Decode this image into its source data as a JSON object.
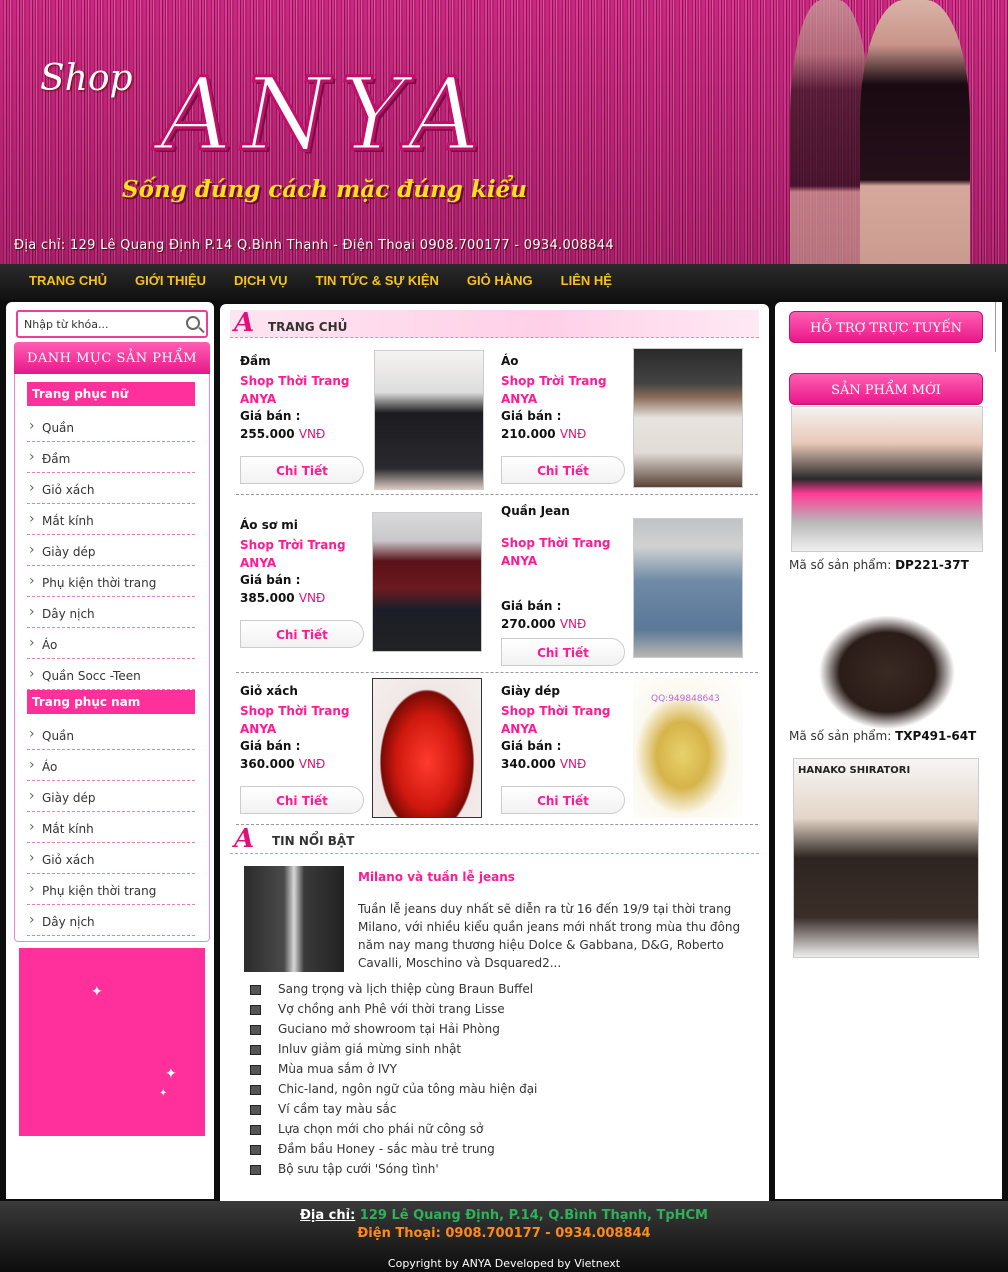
{
  "header": {
    "shop_word": "Shop",
    "brand": "ANYA",
    "slogan": "Sống đúng cách mặc đúng kiểu",
    "address_line": "Địa chỉ: 129 Lê Quang Định P.14 Q.Bình Thạnh - Điện Thoại 0908.700177 - 0934.008844"
  },
  "nav": [
    "TRANG CHỦ",
    "GIỚI THIỆU",
    "DỊCH VỤ",
    "TIN TỨC & SỰ KIỆN",
    "GIỎ HÀNG",
    "LIÊN HỆ"
  ],
  "left": {
    "search_placeholder": "Nhập từ khóa...",
    "category_title": "DANH MỤC SẢN PHẨM",
    "women_title": "Trang phục nữ",
    "women_items": [
      "Quần",
      "Đầm",
      "Giỏ xách",
      "Mắt kính",
      "Giày dép",
      "Phụ kiện thời trang",
      "Dây nịch",
      "Áo",
      "Quần Socc -Teen"
    ],
    "men_title": "Trang phục nam",
    "men_items": [
      "Quần",
      "Áo",
      "Giày dép",
      "Mắt kính",
      "Giỏ xách",
      "Phụ kiện thời trang",
      "Dây nịch"
    ]
  },
  "center": {
    "section_title": "TRANG CHỦ",
    "products": [
      {
        "name": "Đầm",
        "shop": "Shop Thời Trang ANYA",
        "price_label": "Giá bán :",
        "price": "255.000",
        "currency": "VNĐ",
        "button": "Chi Tiết"
      },
      {
        "name": "Áo",
        "shop": "Shop Trời Trang ANYA",
        "price_label": "Giá bán :",
        "price": "210.000",
        "currency": "VNĐ",
        "button": "Chi Tiết"
      },
      {
        "name": "Áo sơ mi",
        "shop": "Shop Trời Trang ANYA",
        "price_label": "Giá bán :",
        "price": "385.000",
        "currency": "VNĐ",
        "button": "Chi Tiết"
      },
      {
        "name": "Quần Jean",
        "shop": "Shop Thời Trang ANYA",
        "price_label": "Giá bán :",
        "price": "270.000",
        "currency": "VNĐ",
        "button": "Chi Tiết"
      },
      {
        "name": "Giỏ xách",
        "shop": "Shop Thời Trang ANYA",
        "price_label": "Giá bán :",
        "price": "360.000",
        "currency": "VNĐ",
        "button": "Chi Tiết"
      },
      {
        "name": "Giày dép",
        "shop": "Shop Thời Trang ANYA",
        "price_label": "Giá bán :",
        "price": "340.000",
        "currency": "VNĐ",
        "button": "Chi Tiết"
      }
    ],
    "shoe_watermark": "QQ:949848643",
    "news_section_title": "TIN NỔI BẬT",
    "featured_title": "Milano và tuần lễ jeans",
    "featured_desc": "Tuần lễ jeans duy nhất sẽ diễn ra từ 16 đến 19/9 tại thời trang Milano, với nhiều kiểu quần jeans mới nhất trong mùa thu đông năm nay mang thương hiệu Dolce & Gabbana, D&G, Roberto Cavalli, Moschino và Dsquared2...",
    "news": [
      "Sang trọng và lịch thiệp cùng Braun Buffel",
      "Vợ chồng anh Phê với thời trang Lisse",
      "Guciano mở showroom tại Hải Phòng",
      "Inluv giảm giá mừng sinh nhật",
      "Mùa mua sắm ở IVY",
      "Chic-land, ngôn ngữ của tông màu hiện đại",
      "Ví cầm tay màu sắc",
      "Lựa chọn mới cho phái nữ công sở",
      "Đầm bầu Honey - sắc màu trẻ trung",
      "Bộ sưu tập cưới 'Sóng tình'"
    ]
  },
  "right": {
    "support_title": "HỖ TRỢ TRỰC TUYẾN",
    "new_products_title": "SẢN PHẨM MỚI",
    "code_label": "Mã số sản phẩm:",
    "codes": [
      "DP221-37T",
      "TXP491-64T"
    ],
    "banner_text": "HANAKO SHIRATORI"
  },
  "footer": {
    "addr_label": "Địa chỉ:",
    "addr_value": "129 Lê Quang Định, P.14, Q.Bình Thạnh, TpHCM",
    "phone": "Điện Thoại: 0908.700177 - 0934.008844",
    "copyright": "Copyright by ANYA Developed by Vietnext"
  }
}
